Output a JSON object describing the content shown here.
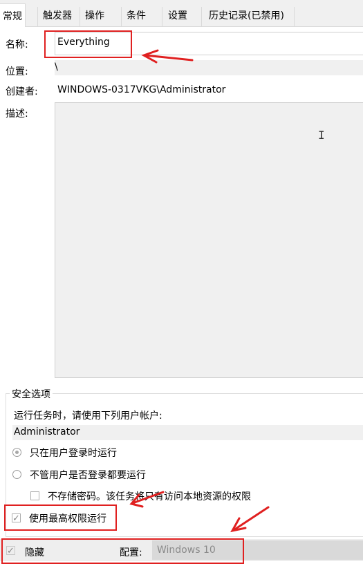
{
  "tabs": [
    "常规",
    "触发器",
    "操作",
    "条件",
    "设置",
    "历史记录(已禁用)"
  ],
  "general": {
    "name_label": "名称:",
    "name_value": "Everything",
    "location_label": "位置:",
    "location_value": "\\",
    "author_label": "创建者:",
    "author_value": "WINDOWS-0317VKG\\Administrator",
    "description_label": "描述:"
  },
  "security": {
    "group_title": "安全选项",
    "run_as_prompt": "运行任务时，请使用下列用户帐户:",
    "user_account": "Administrator",
    "option_logged_on": "只在用户登录时运行",
    "option_whether_logged_on": "不管用户是否登录都要运行",
    "option_no_store_password": "不存储密码。该任务将只有访问本地资源的权限",
    "highest_privileges": "使用最高权限运行"
  },
  "footer": {
    "hidden_label": "隐藏",
    "configure_label": "配置:",
    "configure_value": "Windows 10"
  },
  "colors": {
    "annotation": "#e02020",
    "panel_gray": "#f0f0f0"
  }
}
